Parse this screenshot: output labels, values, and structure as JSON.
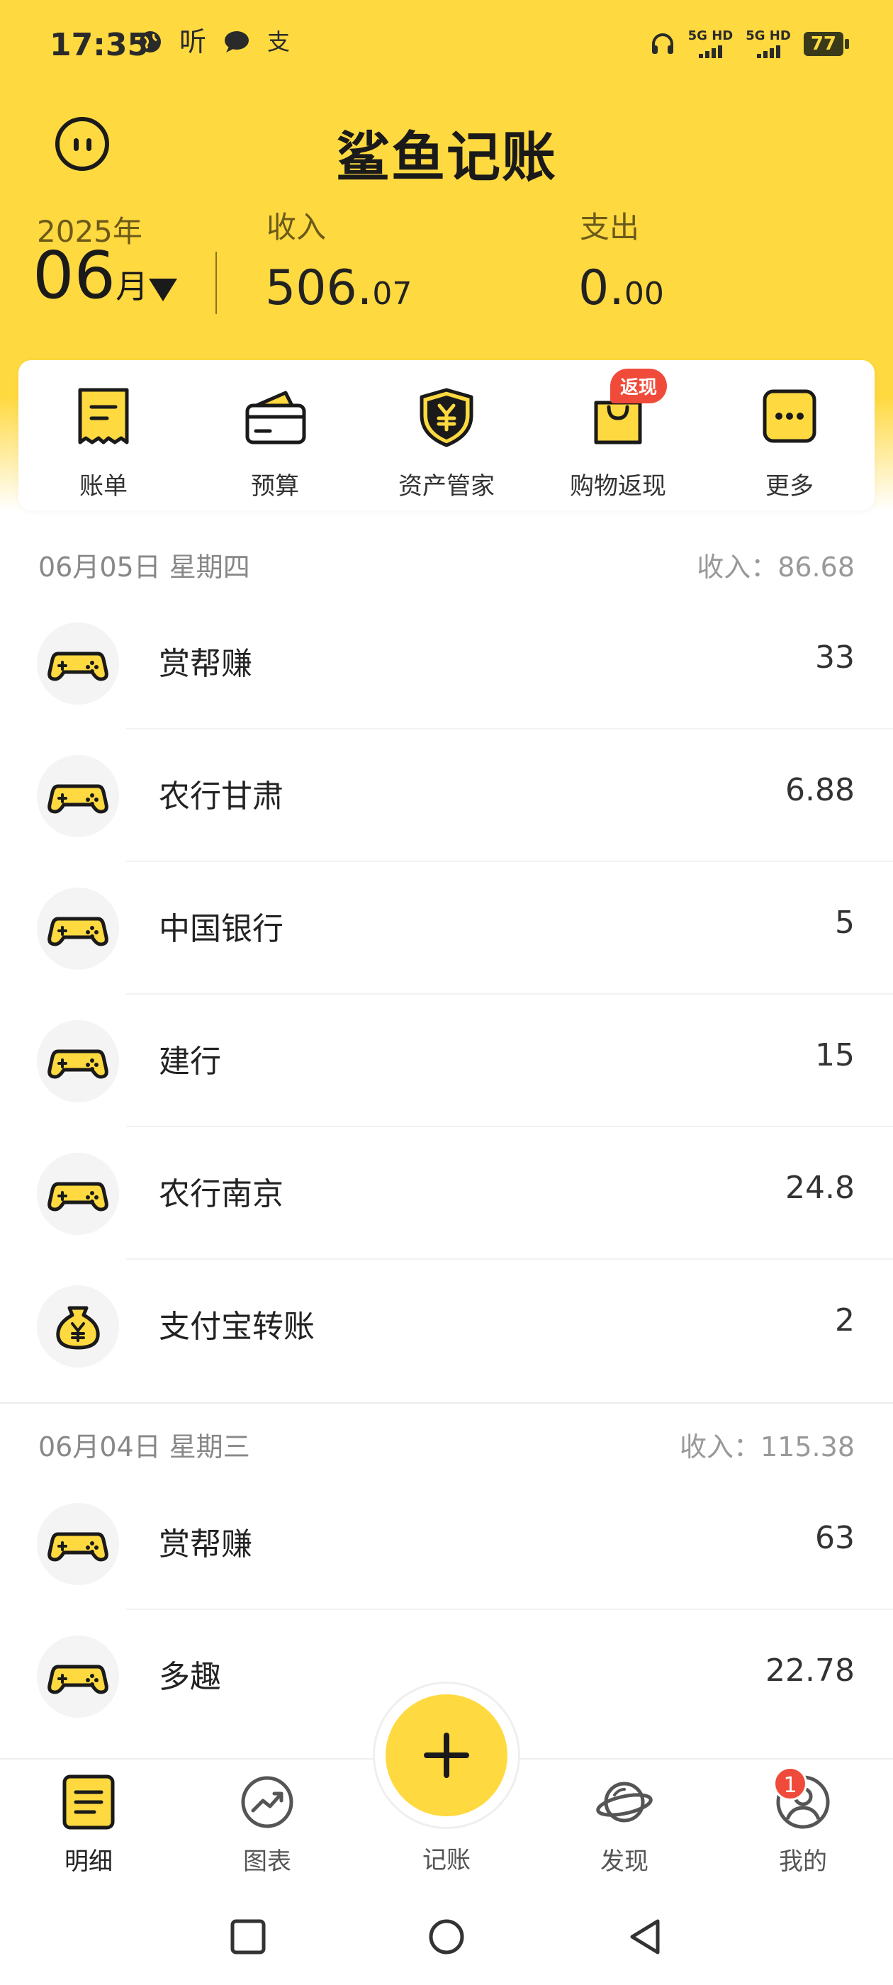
{
  "status_bar": {
    "time": "17:35",
    "left_icons": [
      "globe-icon",
      "听",
      "chat-bubble-icon",
      "支"
    ],
    "signal_1": "5G HD",
    "signal_2": "5G HD",
    "battery": "77"
  },
  "app": {
    "title": "鲨鱼记账",
    "accent_color": "#FFD940"
  },
  "summary": {
    "year": "2025年",
    "month": "06",
    "month_unit": "月",
    "income_label": "收入",
    "income_int": "506.",
    "income_dec": "07",
    "expense_label": "支出",
    "expense_int": "0.",
    "expense_dec": "00"
  },
  "quick_actions": [
    {
      "label": "账单",
      "icon": "bill-icon"
    },
    {
      "label": "预算",
      "icon": "wallet-icon"
    },
    {
      "label": "资产管家",
      "icon": "yuan-shield-icon"
    },
    {
      "label": "购物返现",
      "icon": "shopping-bag-icon",
      "badge": "返现"
    },
    {
      "label": "更多",
      "icon": "more-icon"
    }
  ],
  "days": [
    {
      "date": "06月05日 星期四",
      "income": "收入：86.68",
      "entries": [
        {
          "name": "赏帮赚",
          "amount": "33",
          "icon": "gamepad-icon"
        },
        {
          "name": "农行甘肃",
          "amount": "6.88",
          "icon": "gamepad-icon"
        },
        {
          "name": "中国银行",
          "amount": "5",
          "icon": "gamepad-icon"
        },
        {
          "name": "建行",
          "amount": "15",
          "icon": "gamepad-icon"
        },
        {
          "name": "农行南京",
          "amount": "24.8",
          "icon": "gamepad-icon"
        },
        {
          "name": "支付宝转账",
          "amount": "2",
          "icon": "money-bag-icon"
        }
      ]
    },
    {
      "date": "06月04日 星期三",
      "income": "收入：115.38",
      "entries": [
        {
          "name": "赏帮赚",
          "amount": "63",
          "icon": "gamepad-icon"
        },
        {
          "name": "多趣",
          "amount": "22.78",
          "icon": "gamepad-icon"
        }
      ]
    }
  ],
  "tabs": [
    {
      "label": "明细",
      "icon": "detail-list-icon",
      "active": true
    },
    {
      "label": "图表",
      "icon": "chart-trend-icon"
    },
    {
      "label": "记账",
      "icon": "plus-icon"
    },
    {
      "label": "发现",
      "icon": "planet-icon"
    },
    {
      "label": "我的",
      "icon": "profile-icon",
      "badge": "1"
    }
  ]
}
